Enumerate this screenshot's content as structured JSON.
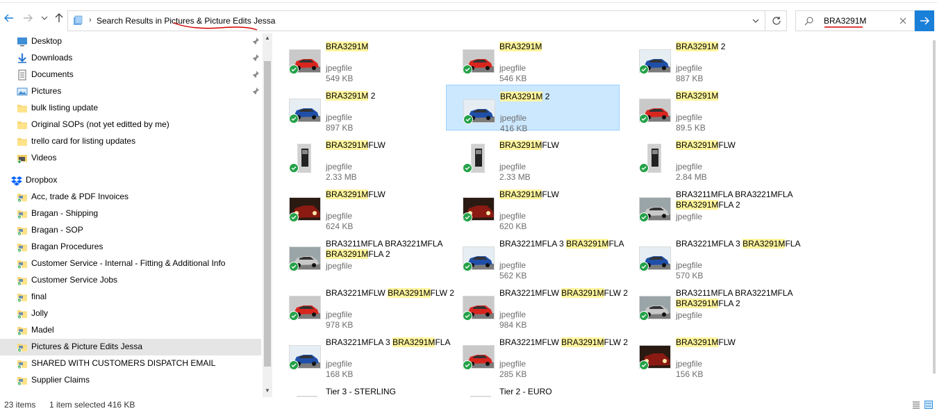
{
  "nav": {
    "back_icon": "arrow-left-icon",
    "forward_icon": "arrow-right-icon",
    "recent_icon": "chevron-down-icon",
    "up_icon": "arrow-up-icon"
  },
  "address": {
    "path": "Search Results in Pictures & Picture Edits Jessa"
  },
  "search": {
    "query": "BRA3291M"
  },
  "sidebar": {
    "quick_access": [
      {
        "label": "Desktop",
        "icon": "desktop-icon",
        "pinned": true
      },
      {
        "label": "Downloads",
        "icon": "download-icon",
        "pinned": true
      },
      {
        "label": "Documents",
        "icon": "documents-icon",
        "pinned": true
      },
      {
        "label": "Pictures",
        "icon": "pictures-icon",
        "pinned": true
      },
      {
        "label": "bulk listing update",
        "icon": "folder-icon",
        "pinned": false
      },
      {
        "label": "Original SOPs (not yet editted by me)",
        "icon": "folder-icon",
        "pinned": false
      },
      {
        "label": "trello card for listing updates",
        "icon": "folder-icon",
        "pinned": false
      },
      {
        "label": "Videos",
        "icon": "videos-icon",
        "pinned": false
      }
    ],
    "dropbox_label": "Dropbox",
    "dropbox_items": [
      {
        "label": "Acc, trade & PDF Invoices"
      },
      {
        "label": "Bragan - Shipping"
      },
      {
        "label": "Bragan - SOP"
      },
      {
        "label": "Bragan Procedures"
      },
      {
        "label": "Customer Service - Internal - Fitting & Additional Info"
      },
      {
        "label": "Customer Service Jobs"
      },
      {
        "label": "final"
      },
      {
        "label": "Jolly"
      },
      {
        "label": "Madel"
      },
      {
        "label": "Pictures & Picture Edits Jessa",
        "selected": true
      },
      {
        "label": "SHARED WITH CUSTOMERS DISPATCH EMAIL"
      },
      {
        "label": "Supplier Claims"
      }
    ]
  },
  "results": [
    {
      "pre": "",
      "hl": "BRA3291M",
      "post": "",
      "line2_pre": "",
      "line2_hl": "",
      "line2_post": "",
      "type": "jpegfile",
      "size": "549 KB",
      "thumb": "red-car"
    },
    {
      "pre": "",
      "hl": "BRA3291M",
      "post": "",
      "line2_pre": "",
      "line2_hl": "",
      "line2_post": "",
      "type": "jpegfile",
      "size": "546 KB",
      "thumb": "red-car"
    },
    {
      "pre": "",
      "hl": "BRA3291M",
      "post": " 2",
      "line2_pre": "",
      "line2_hl": "",
      "line2_post": "",
      "type": "jpegfile",
      "size": "887 KB",
      "thumb": "blue-car"
    },
    {
      "pre": "",
      "hl": "BRA3291M",
      "post": " 2",
      "line2_pre": "",
      "line2_hl": "",
      "line2_post": "",
      "type": "jpegfile",
      "size": "897 KB",
      "thumb": "blue-car"
    },
    {
      "pre": "",
      "hl": "BRA3291M",
      "post": " 2",
      "line2_pre": "",
      "line2_hl": "",
      "line2_post": "",
      "type": "jpegfile",
      "size": "416 KB",
      "thumb": "blue-car",
      "selected": true
    },
    {
      "pre": "",
      "hl": "BRA3291M",
      "post": "",
      "line2_pre": "",
      "line2_hl": "",
      "line2_post": "",
      "type": "jpegfile",
      "size": "89.5 KB",
      "thumb": "red-car"
    },
    {
      "pre": "",
      "hl": "BRA3291M",
      "post": "FLW",
      "line2_pre": "",
      "line2_hl": "",
      "line2_post": "",
      "type": "jpegfile",
      "size": "2.33 MB",
      "thumb": "portrait"
    },
    {
      "pre": "",
      "hl": "BRA3291M",
      "post": "FLW",
      "line2_pre": "",
      "line2_hl": "",
      "line2_post": "",
      "type": "jpegfile",
      "size": "2.33 MB",
      "thumb": "portrait"
    },
    {
      "pre": "",
      "hl": "BRA3291M",
      "post": "FLW",
      "line2_pre": "",
      "line2_hl": "",
      "line2_post": "",
      "type": "jpegfile",
      "size": "2.84 MB",
      "thumb": "portrait"
    },
    {
      "pre": "",
      "hl": "BRA3291M",
      "post": "FLW",
      "line2_pre": "",
      "line2_hl": "",
      "line2_post": "",
      "type": "jpegfile",
      "size": "624 KB",
      "thumb": "dark-car"
    },
    {
      "pre": "",
      "hl": "BRA3291M",
      "post": "FLW",
      "line2_pre": "",
      "line2_hl": "",
      "line2_post": "",
      "type": "jpegfile",
      "size": "620 KB",
      "thumb": "dark-car"
    },
    {
      "pre": "BRA3211MFLA BRA3221MFLA",
      "hl": "",
      "post": "",
      "line2_pre": "",
      "line2_hl": "BRA3291M",
      "line2_post": "FLA 2",
      "type": "jpegfile",
      "size": "",
      "thumb": "silver-car"
    },
    {
      "pre": "BRA3211MFLA BRA3221MFLA",
      "hl": "",
      "post": "",
      "line2_pre": "",
      "line2_hl": "BRA3291M",
      "line2_post": "FLA 2",
      "type": "jpegfile",
      "size": "",
      "thumb": "silver-car"
    },
    {
      "pre": "BRA3221MFLA 3 ",
      "hl": "BRA3291M",
      "post": "FLA",
      "line2_pre": "",
      "line2_hl": "",
      "line2_post": "",
      "type": "jpegfile",
      "size": "562 KB",
      "thumb": "blue-car"
    },
    {
      "pre": "BRA3221MFLA 3 ",
      "hl": "BRA3291M",
      "post": "FLA",
      "line2_pre": "",
      "line2_hl": "",
      "line2_post": "",
      "type": "jpegfile",
      "size": "570 KB",
      "thumb": "blue-car"
    },
    {
      "pre": "BRA3221MFLW ",
      "hl": "BRA3291M",
      "post": "FLW 2",
      "line2_pre": "",
      "line2_hl": "",
      "line2_post": "",
      "type": "jpegfile",
      "size": "978 KB",
      "thumb": "red-car"
    },
    {
      "pre": "BRA3221MFLW ",
      "hl": "BRA3291M",
      "post": "FLW 2",
      "line2_pre": "",
      "line2_hl": "",
      "line2_post": "",
      "type": "jpegfile",
      "size": "984 KB",
      "thumb": "red-car"
    },
    {
      "pre": "BRA3211MFLA BRA3221MFLA",
      "hl": "",
      "post": "",
      "line2_pre": "",
      "line2_hl": "BRA3291M",
      "line2_post": "FLA 2",
      "type": "jpegfile",
      "size": "",
      "thumb": "silver-car"
    },
    {
      "pre": "BRA3221MFLA 3 ",
      "hl": "BRA3291M",
      "post": "FLA",
      "line2_pre": "",
      "line2_hl": "",
      "line2_post": "",
      "type": "jpegfile",
      "size": "168 KB",
      "thumb": "blue-car"
    },
    {
      "pre": "BRA3221MFLW ",
      "hl": "BRA3291M",
      "post": "FLW 2",
      "line2_pre": "",
      "line2_hl": "",
      "line2_post": "",
      "type": "jpegfile",
      "size": "285 KB",
      "thumb": "red-car"
    },
    {
      "pre": "",
      "hl": "BRA3291M",
      "post": "FLW",
      "line2_pre": "",
      "line2_hl": "",
      "line2_post": "",
      "type": "jpegfile",
      "size": "156 KB",
      "thumb": "dark-car"
    },
    {
      "pre": "Tier 3 - STERLING",
      "hl": "",
      "post": "",
      "line2_pre": "",
      "line2_hl": "",
      "line2_post": "",
      "type": "",
      "size": "",
      "thumb": "excel"
    },
    {
      "pre": "Tier 2 - EURO",
      "hl": "",
      "post": "",
      "line2_pre": "",
      "line2_hl": "",
      "line2_post": "",
      "type": "",
      "size": "",
      "thumb": "excel"
    }
  ],
  "status": {
    "count": "23 items",
    "selection": "1 item selected  416 KB"
  },
  "colors": {
    "accent": "#1a7fd8",
    "highlight": "#fff59d",
    "selection": "#cce8ff",
    "sync_green": "#24a148",
    "annotation_red": "#d40000"
  }
}
